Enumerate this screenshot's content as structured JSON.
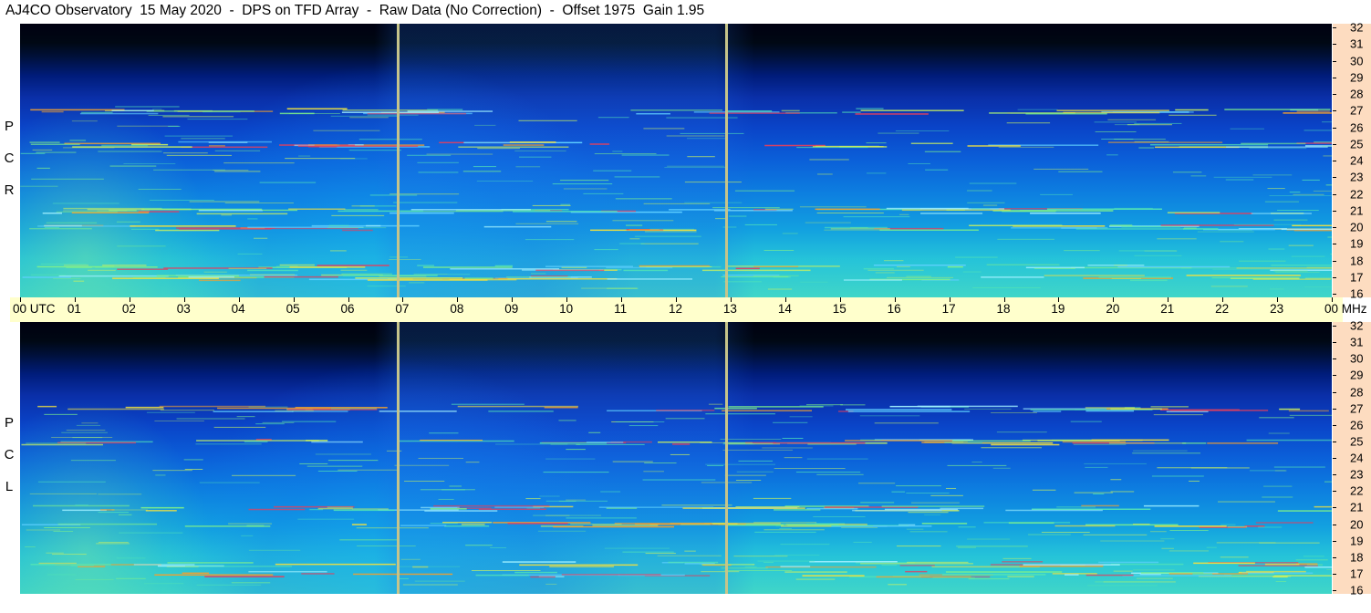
{
  "title": "AJ4CO Observatory  15 May 2020  -  DPS on TFD Array  -  Raw Data (No Correction)  -  Offset 1975  Gain 1.95",
  "panels": [
    {
      "name": "RCP",
      "side_label": [
        "R",
        "C",
        "P"
      ]
    },
    {
      "name": "LCP",
      "side_label": [
        "L",
        "C",
        "P"
      ]
    }
  ],
  "colors": {
    "accent_time_axis": "#ffffcc",
    "accent_freq_axis": "#fddcc0",
    "marker": "#c6c48a"
  },
  "chart_data": {
    "type": "heatmap",
    "title": "AJ4CO Observatory  15 May 2020  -  DPS on TFD Array  -  Raw Data (No Correction)  -  Offset 1975  Gain 1.95",
    "x_axis": {
      "start_label": "00 UTC",
      "end_label": "00",
      "labels": [
        "00",
        "01",
        "02",
        "03",
        "04",
        "05",
        "06",
        "07",
        "08",
        "09",
        "10",
        "11",
        "12",
        "13",
        "14",
        "15",
        "16",
        "17",
        "18",
        "19",
        "20",
        "21",
        "22",
        "23",
        "00"
      ],
      "unit": "UTC",
      "range_hours": [
        0,
        24
      ]
    },
    "y_axis": {
      "unit": "MHz",
      "range": [
        16,
        32
      ],
      "labels": [
        "16",
        "17",
        "18",
        "19",
        "20",
        "21",
        "22",
        "23",
        "24",
        "25",
        "26",
        "27",
        "28",
        "29",
        "30",
        "31",
        "32"
      ]
    },
    "panels": [
      "RCP",
      "LCP"
    ],
    "markers_utc_hours": [
      6.9,
      12.9
    ],
    "strong_bands_mhz": [
      17.0,
      17.6,
      27.0,
      21.0,
      20.0,
      25.0
    ],
    "grid": false
  }
}
